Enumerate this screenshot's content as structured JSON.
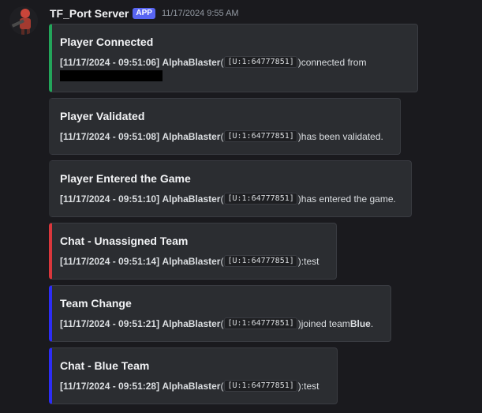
{
  "header": {
    "username": "TF_Port Server",
    "app_tag": "APP",
    "timestamp": "11/17/2024 9:55 AM"
  },
  "colors": {
    "green": "#23a55a",
    "neutral": "#2b2d31",
    "red": "#da373c",
    "blue": "#2d2df5"
  },
  "embeds": [
    {
      "title": "Player Connected",
      "time": "[11/17/2024 - 09:51:06]",
      "player": "AlphaBlaster",
      "paren_open": " (",
      "steam_id": "[U:1:64777851]",
      "paren_close": ")",
      "text": " connected from"
    },
    {
      "title": "Player Validated",
      "time": "[11/17/2024 - 09:51:08]",
      "player": "AlphaBlaster",
      "paren_open": " (",
      "steam_id": "[U:1:64777851]",
      "paren_close": ")",
      "text": " has been validated."
    },
    {
      "title": "Player Entered the Game",
      "time": "[11/17/2024 - 09:51:10]",
      "player": "AlphaBlaster",
      "paren_open": " (",
      "steam_id": "[U:1:64777851]",
      "paren_close": ")",
      "text": " has entered the game."
    },
    {
      "title": "Chat - Unassigned Team",
      "time": "[11/17/2024 - 09:51:14]",
      "player": "AlphaBlaster",
      "paren_open": " (",
      "steam_id": "[U:1:64777851]",
      "paren_close": "):",
      "text": " test"
    },
    {
      "title": "Team Change",
      "time": "[11/17/2024 - 09:51:21]",
      "player": "AlphaBlaster",
      "paren_open": " (",
      "steam_id": "[U:1:64777851]",
      "paren_close": ")",
      "text": " joined team ",
      "team": "Blue",
      "end": "."
    },
    {
      "title": "Chat - Blue Team",
      "time": "[11/17/2024 - 09:51:28]",
      "player": "AlphaBlaster",
      "paren_open": " (",
      "steam_id": "[U:1:64777851]",
      "paren_close": "):",
      "text": " test"
    }
  ]
}
